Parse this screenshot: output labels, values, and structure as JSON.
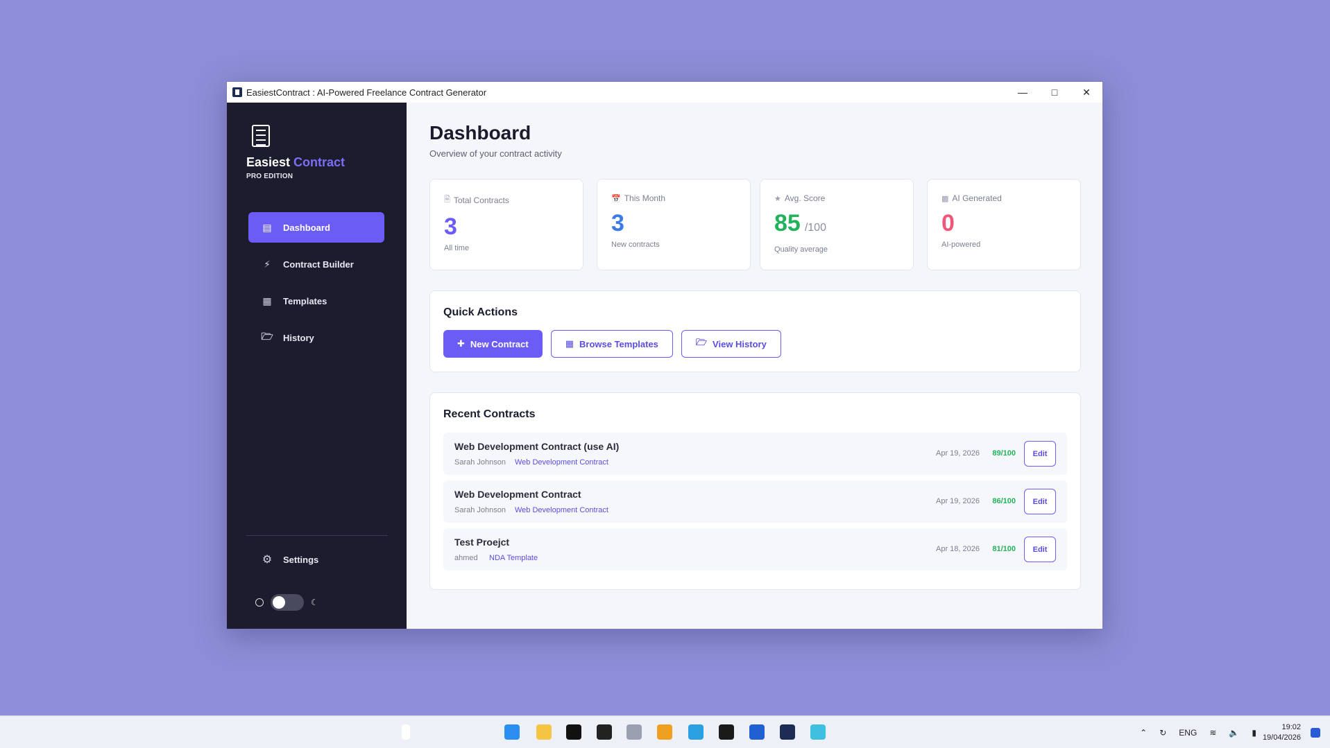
{
  "window": {
    "title": "EasiestContract : AI-Powered Freelance Contract Generator",
    "controls": [
      "minimize",
      "maximize",
      "close"
    ]
  },
  "sidebar": {
    "brand_part1": "Easiest",
    "brand_part2": "Contract",
    "edition": "PRO EDITION",
    "items": [
      {
        "label": "Dashboard",
        "icon": "chart-icon",
        "active": true
      },
      {
        "label": "Contract Builder",
        "icon": "lightning-icon",
        "active": false
      },
      {
        "label": "Templates",
        "icon": "template-icon",
        "active": false
      },
      {
        "label": "History",
        "icon": "folder-icon",
        "active": false
      }
    ],
    "settings_label": "Settings",
    "theme_toggle": "light"
  },
  "main": {
    "title": "Dashboard",
    "subtitle": "Overview of your contract activity",
    "stats": [
      {
        "label": "Total Contracts",
        "value": "3",
        "unit": "",
        "foot": "All time",
        "color": "#6b5cf6"
      },
      {
        "label": "This Month",
        "value": "3",
        "unit": "",
        "foot": "New contracts",
        "color": "#3b7be8"
      },
      {
        "label": "Avg. Score",
        "value": "85",
        "unit": "/100",
        "foot": "Quality average",
        "color": "#22b35a"
      },
      {
        "label": "AI Generated",
        "value": "0",
        "unit": "",
        "foot": "AI-powered",
        "color": "#f0567a"
      }
    ],
    "quick_actions": {
      "title": "Quick Actions",
      "buttons": [
        "New Contract",
        "Browse Templates",
        "View History"
      ]
    },
    "recent": {
      "title": "Recent Contracts",
      "rows": [
        {
          "title": "Web Development Contract (use AI)",
          "client": "Sarah Johnson",
          "template": "Web Development Contract",
          "date": "Apr 19, 2026",
          "score": "89/100",
          "action": "Edit"
        },
        {
          "title": "Web Development Contract",
          "client": "Sarah Johnson",
          "template": "Web Development Contract",
          "date": "Apr 19, 2026",
          "score": "86/100",
          "action": "Edit"
        },
        {
          "title": "Test Proejct",
          "client": "ahmed",
          "template": "NDA Template",
          "date": "Apr 18, 2026",
          "score": "81/100",
          "action": "Edit"
        }
      ]
    }
  },
  "taskbar": {
    "language": "ENG",
    "time": "19:02",
    "date": "19/04/2026"
  }
}
